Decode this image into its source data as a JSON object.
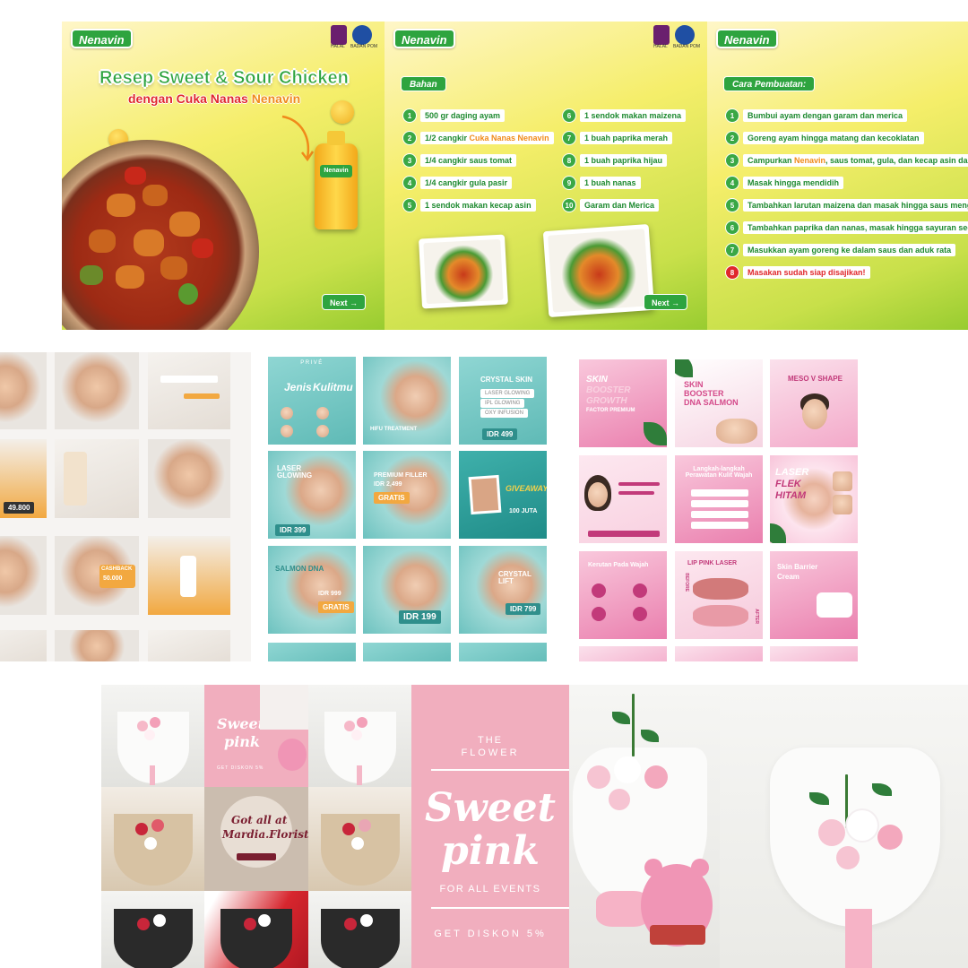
{
  "recipe": {
    "brand": "Nenavin",
    "cert_labels": [
      "HALAL",
      "BADAN POM"
    ],
    "title_line1": "Resep Sweet & Sour Chicken",
    "title_line2_prefix": "dengan Cuka Nanas ",
    "title_line2_brand": "Nenavin",
    "bottle_label": "Nenavin",
    "next_label": "Next →",
    "bahan_label": "Bahan",
    "bahan_left": [
      {
        "num": "1",
        "text": "500 gr daging ayam"
      },
      {
        "num": "2",
        "text_prefix": "1/2 cangkir ",
        "text_hl": "Cuka Nanas Nenavin"
      },
      {
        "num": "3",
        "text": "1/4 cangkir saus tomat"
      },
      {
        "num": "4",
        "text": "1/4 cangkir gula pasir"
      },
      {
        "num": "5",
        "text": "1 sendok makan kecap asin"
      }
    ],
    "bahan_right": [
      {
        "num": "6",
        "text": "1 sendok makan maizena"
      },
      {
        "num": "7",
        "text": "1 buah paprika merah"
      },
      {
        "num": "8",
        "text": "1 buah paprika hijau"
      },
      {
        "num": "9",
        "text": "1 buah nanas"
      },
      {
        "num": "10",
        "text": "Garam dan Merica"
      }
    ],
    "cara_label": "Cara Pembuatan:",
    "cara_steps": [
      {
        "num": "1",
        "text": "Bumbui ayam dengan garam dan merica"
      },
      {
        "num": "2",
        "text": "Goreng ayam hingga matang dan kecoklatan"
      },
      {
        "num": "3",
        "text_prefix": "Campurkan ",
        "text_hl": "Nenavin",
        "text_suffix": ", saus tomat, gula, dan kecap asin dal"
      },
      {
        "num": "4",
        "text": "Masak hingga mendidih"
      },
      {
        "num": "5",
        "text": "Tambahkan larutan maizena dan masak hingga saus meng"
      },
      {
        "num": "6",
        "text": "Tambahkan paprika dan nanas, masak hingga sayuran sed"
      },
      {
        "num": "7",
        "text": "Masukkan ayam goreng ke dalam saus dan aduk rata"
      },
      {
        "num": "8",
        "text": "Masakan sudah siap disajikan!"
      }
    ]
  },
  "skincare_a": {
    "price_tag": "49.800",
    "cashback": "CASHBACK",
    "cashback_value": "50.000"
  },
  "skincare_b": {
    "brand": "PRIVÉ",
    "t1_line1": "Jenis",
    "t1_line2": "Kulitmu",
    "t2": "HIFU TREATMENT",
    "t3_title": "CRYSTAL SKIN",
    "t3_items": [
      "LASER GLOWING",
      "IPL GLOWING",
      "OXY INFUSION"
    ],
    "t3_price": "IDR 499",
    "t4_title": "LASER GLOWING",
    "t4_price": "IDR 399",
    "t5_title": "PREMIUM FILLER",
    "t5_price": "IDR 2,499",
    "t5_badge": "GRATIS",
    "t6_title": "GIVEAWAY",
    "t6_sub": "100 JUTA",
    "t7_title": "SALMON DNA",
    "t7_price": "IDR 999",
    "t7_badge": "GRATIS",
    "t8_price": "IDR 199",
    "t9_title": "CRYSTAL LIFT",
    "t9_price": "IDR 799"
  },
  "skincare_c": {
    "t1_line1": "SKIN",
    "t1_line2": "BOOSTER",
    "t1_line3": "GROWTH",
    "t1_line4": "FACTOR PREMIUM",
    "t2_line1": "SKIN",
    "t2_line2": "BOOSTER",
    "t2_line3": "DNA SALMON",
    "t3_title": "MESO V SHAPE",
    "t5_title": "Langkah-langkah Perawatan Kulit Wajah",
    "t6_line1": "LASER",
    "t6_line2": "FLEK",
    "t6_line3": "HITAM",
    "t7_title": "Kerutan Pada Wajah",
    "t8_title": "LIP PINK LASER",
    "t8_before": "BEFORE",
    "t8_after": "AFTER",
    "t9_line1": "Skin Barrier",
    "t9_line2": "Cream"
  },
  "florist": {
    "mini_sweet": "Sweet",
    "mini_pink": "pink",
    "mini_diskon": "GET DISKON 5%",
    "center_line1": "Got all at",
    "center_line2": "Mardia.Florist",
    "big_the": "THE",
    "big_flower": "FLOWER",
    "big_sweet": "Sweet",
    "big_pink": "pink",
    "big_events": "FOR ALL EVENTS",
    "big_diskon": "GET  DISKON 5%"
  },
  "colors": {
    "brand_green": "#2ea43f",
    "accent_orange": "#f08a1a",
    "accent_red": "#e0282c",
    "teal": "#5fbab6",
    "pink": "#f1aebe"
  }
}
